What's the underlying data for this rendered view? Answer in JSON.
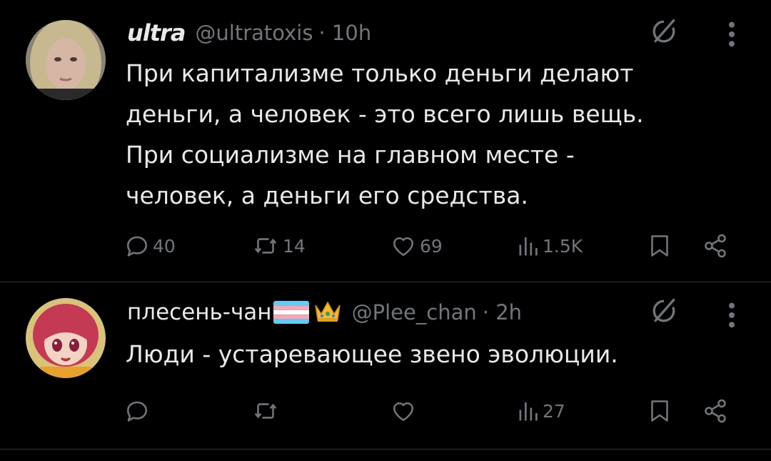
{
  "tweets": [
    {
      "display_name": "ultra",
      "handle": "@ultratoxis",
      "time": "· 10h",
      "text": "При капитализме только деньги делают\nденьги, а человек - это всего лишь вещь.\nПри социализме на главном месте -\nчеловек, а деньги его средства.",
      "replies": "40",
      "reposts": "14",
      "likes": "69",
      "views": "1.5K"
    },
    {
      "display_name": "плесень-чан",
      "handle": "@Plee_chan",
      "time": "· 2h",
      "text": "Люди - устаревающее звено эволюции.",
      "replies": "",
      "reposts": "",
      "likes": "",
      "views": "27"
    }
  ],
  "icons": {
    "reply": "reply-icon",
    "repost": "repost-icon",
    "like": "heart-icon",
    "views": "views-icon",
    "bookmark": "bookmark-icon",
    "share": "share-icon",
    "grok": "grok-icon",
    "more": "more-icon"
  },
  "colors": {
    "background": "#000000",
    "text": "#e7e9ea",
    "muted": "#71767b",
    "divider": "#2f3336"
  }
}
